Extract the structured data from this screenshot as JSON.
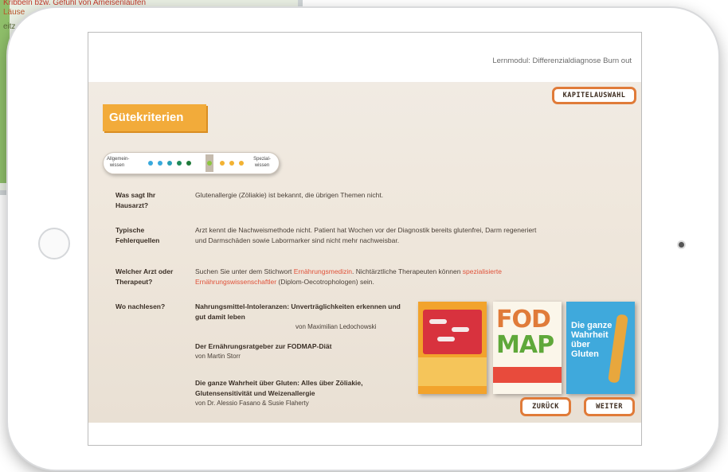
{
  "background_window": {
    "line1": "Kribbeln bzw. Gefühl von Ameisenlaufen",
    "line2": "Läuse",
    "line3": "eitz"
  },
  "module_title": "Lernmodul: Differenzialdiagnose Burn out",
  "buttons": {
    "kapitel": "KAPITELAUSWAHL",
    "back": "ZURÜCK",
    "next": "WEITER"
  },
  "section_title": "Gütekriterien",
  "scale": {
    "left_label": "Allgemein-wissen",
    "right_label": "Spezial-wissen",
    "dot_colors": [
      "#39a9dc",
      "#39a9dc",
      "#2a9fb5",
      "#1f8a5a",
      "#1f7a3a",
      "#8cc63e",
      "#f2b233",
      "#f2b233",
      "#f2b233"
    ]
  },
  "rows": {
    "hausarzt": {
      "label": "Was sagt Ihr Hausarzt?",
      "text": "Glutenallergie (Zöliakie) ist bekannt, die übrigen Themen nicht."
    },
    "fehlerquellen": {
      "label": "Typische Fehlerquellen",
      "text": "Arzt kennt die Nachweismethode nicht. Patient hat Wochen vor der Diagnostik bereits glutenfrei, Darm regeneriert und Darmschäden sowie Labormarker sind nicht mehr nachweisbar."
    },
    "arzt": {
      "label": "Welcher Arzt oder Therapeut?",
      "text_pre": "Suchen Sie unter dem Stichwort ",
      "link1": "Ernährungsmedizin",
      "text_mid": ". Nichtärztliche Therapeuten können ",
      "link2": "spezialisierte Ernährungswissenschaftler",
      "text_post": " (Diplom-Oecotrophologen) sein."
    },
    "nachlesen": {
      "label": "Wo nachlesen?"
    }
  },
  "books": [
    {
      "title": "Nahrungsmittel-Intoleranzen: Unverträglichkeiten erkennen und gut damit leben",
      "author": "von Maximilian Ledochowski"
    },
    {
      "title": "Der Ernährungsratgeber zur FODMAP-Diät",
      "author": "von Martin Storr"
    },
    {
      "title": "Die ganze Wahrheit über Gluten: Alles über Zöliakie, Glutensensitivität und Weizenallergie",
      "author": "von Dr. Alessio Fasano & Susie Flaherty"
    }
  ],
  "covers": {
    "cover2_top": "FOD",
    "cover2_bottom": "MAP",
    "cover3_title": "Die ganze Wahrheit über Gluten"
  }
}
